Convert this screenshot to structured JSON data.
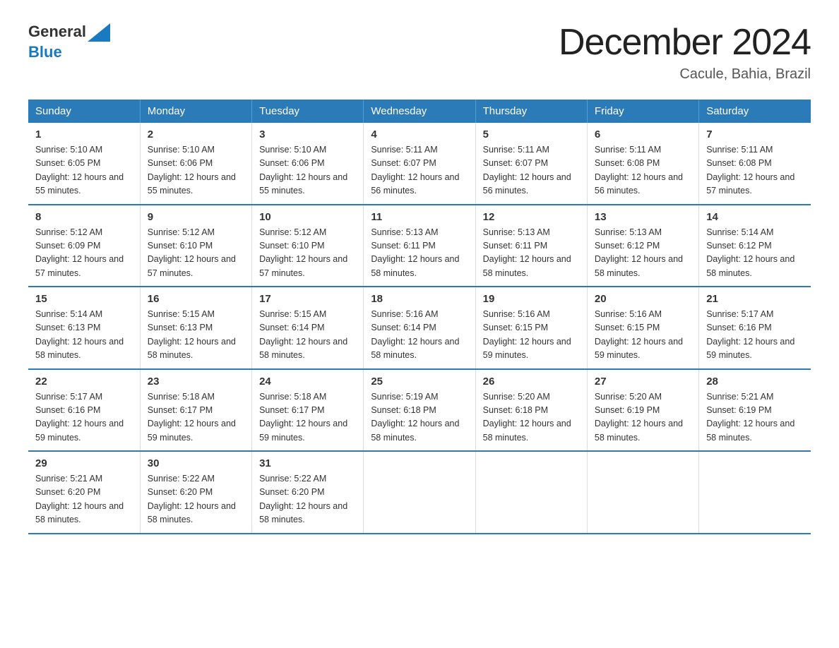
{
  "header": {
    "logo_general": "General",
    "logo_blue": "Blue",
    "month_year": "December 2024",
    "location": "Cacule, Bahia, Brazil"
  },
  "weekdays": [
    "Sunday",
    "Monday",
    "Tuesday",
    "Wednesday",
    "Thursday",
    "Friday",
    "Saturday"
  ],
  "weeks": [
    [
      {
        "day": "1",
        "sunrise": "5:10 AM",
        "sunset": "6:05 PM",
        "daylight": "12 hours and 55 minutes."
      },
      {
        "day": "2",
        "sunrise": "5:10 AM",
        "sunset": "6:06 PM",
        "daylight": "12 hours and 55 minutes."
      },
      {
        "day": "3",
        "sunrise": "5:10 AM",
        "sunset": "6:06 PM",
        "daylight": "12 hours and 55 minutes."
      },
      {
        "day": "4",
        "sunrise": "5:11 AM",
        "sunset": "6:07 PM",
        "daylight": "12 hours and 56 minutes."
      },
      {
        "day": "5",
        "sunrise": "5:11 AM",
        "sunset": "6:07 PM",
        "daylight": "12 hours and 56 minutes."
      },
      {
        "day": "6",
        "sunrise": "5:11 AM",
        "sunset": "6:08 PM",
        "daylight": "12 hours and 56 minutes."
      },
      {
        "day": "7",
        "sunrise": "5:11 AM",
        "sunset": "6:08 PM",
        "daylight": "12 hours and 57 minutes."
      }
    ],
    [
      {
        "day": "8",
        "sunrise": "5:12 AM",
        "sunset": "6:09 PM",
        "daylight": "12 hours and 57 minutes."
      },
      {
        "day": "9",
        "sunrise": "5:12 AM",
        "sunset": "6:10 PM",
        "daylight": "12 hours and 57 minutes."
      },
      {
        "day": "10",
        "sunrise": "5:12 AM",
        "sunset": "6:10 PM",
        "daylight": "12 hours and 57 minutes."
      },
      {
        "day": "11",
        "sunrise": "5:13 AM",
        "sunset": "6:11 PM",
        "daylight": "12 hours and 58 minutes."
      },
      {
        "day": "12",
        "sunrise": "5:13 AM",
        "sunset": "6:11 PM",
        "daylight": "12 hours and 58 minutes."
      },
      {
        "day": "13",
        "sunrise": "5:13 AM",
        "sunset": "6:12 PM",
        "daylight": "12 hours and 58 minutes."
      },
      {
        "day": "14",
        "sunrise": "5:14 AM",
        "sunset": "6:12 PM",
        "daylight": "12 hours and 58 minutes."
      }
    ],
    [
      {
        "day": "15",
        "sunrise": "5:14 AM",
        "sunset": "6:13 PM",
        "daylight": "12 hours and 58 minutes."
      },
      {
        "day": "16",
        "sunrise": "5:15 AM",
        "sunset": "6:13 PM",
        "daylight": "12 hours and 58 minutes."
      },
      {
        "day": "17",
        "sunrise": "5:15 AM",
        "sunset": "6:14 PM",
        "daylight": "12 hours and 58 minutes."
      },
      {
        "day": "18",
        "sunrise": "5:16 AM",
        "sunset": "6:14 PM",
        "daylight": "12 hours and 58 minutes."
      },
      {
        "day": "19",
        "sunrise": "5:16 AM",
        "sunset": "6:15 PM",
        "daylight": "12 hours and 59 minutes."
      },
      {
        "day": "20",
        "sunrise": "5:16 AM",
        "sunset": "6:15 PM",
        "daylight": "12 hours and 59 minutes."
      },
      {
        "day": "21",
        "sunrise": "5:17 AM",
        "sunset": "6:16 PM",
        "daylight": "12 hours and 59 minutes."
      }
    ],
    [
      {
        "day": "22",
        "sunrise": "5:17 AM",
        "sunset": "6:16 PM",
        "daylight": "12 hours and 59 minutes."
      },
      {
        "day": "23",
        "sunrise": "5:18 AM",
        "sunset": "6:17 PM",
        "daylight": "12 hours and 59 minutes."
      },
      {
        "day": "24",
        "sunrise": "5:18 AM",
        "sunset": "6:17 PM",
        "daylight": "12 hours and 59 minutes."
      },
      {
        "day": "25",
        "sunrise": "5:19 AM",
        "sunset": "6:18 PM",
        "daylight": "12 hours and 58 minutes."
      },
      {
        "day": "26",
        "sunrise": "5:20 AM",
        "sunset": "6:18 PM",
        "daylight": "12 hours and 58 minutes."
      },
      {
        "day": "27",
        "sunrise": "5:20 AM",
        "sunset": "6:19 PM",
        "daylight": "12 hours and 58 minutes."
      },
      {
        "day": "28",
        "sunrise": "5:21 AM",
        "sunset": "6:19 PM",
        "daylight": "12 hours and 58 minutes."
      }
    ],
    [
      {
        "day": "29",
        "sunrise": "5:21 AM",
        "sunset": "6:20 PM",
        "daylight": "12 hours and 58 minutes."
      },
      {
        "day": "30",
        "sunrise": "5:22 AM",
        "sunset": "6:20 PM",
        "daylight": "12 hours and 58 minutes."
      },
      {
        "day": "31",
        "sunrise": "5:22 AM",
        "sunset": "6:20 PM",
        "daylight": "12 hours and 58 minutes."
      },
      null,
      null,
      null,
      null
    ]
  ]
}
